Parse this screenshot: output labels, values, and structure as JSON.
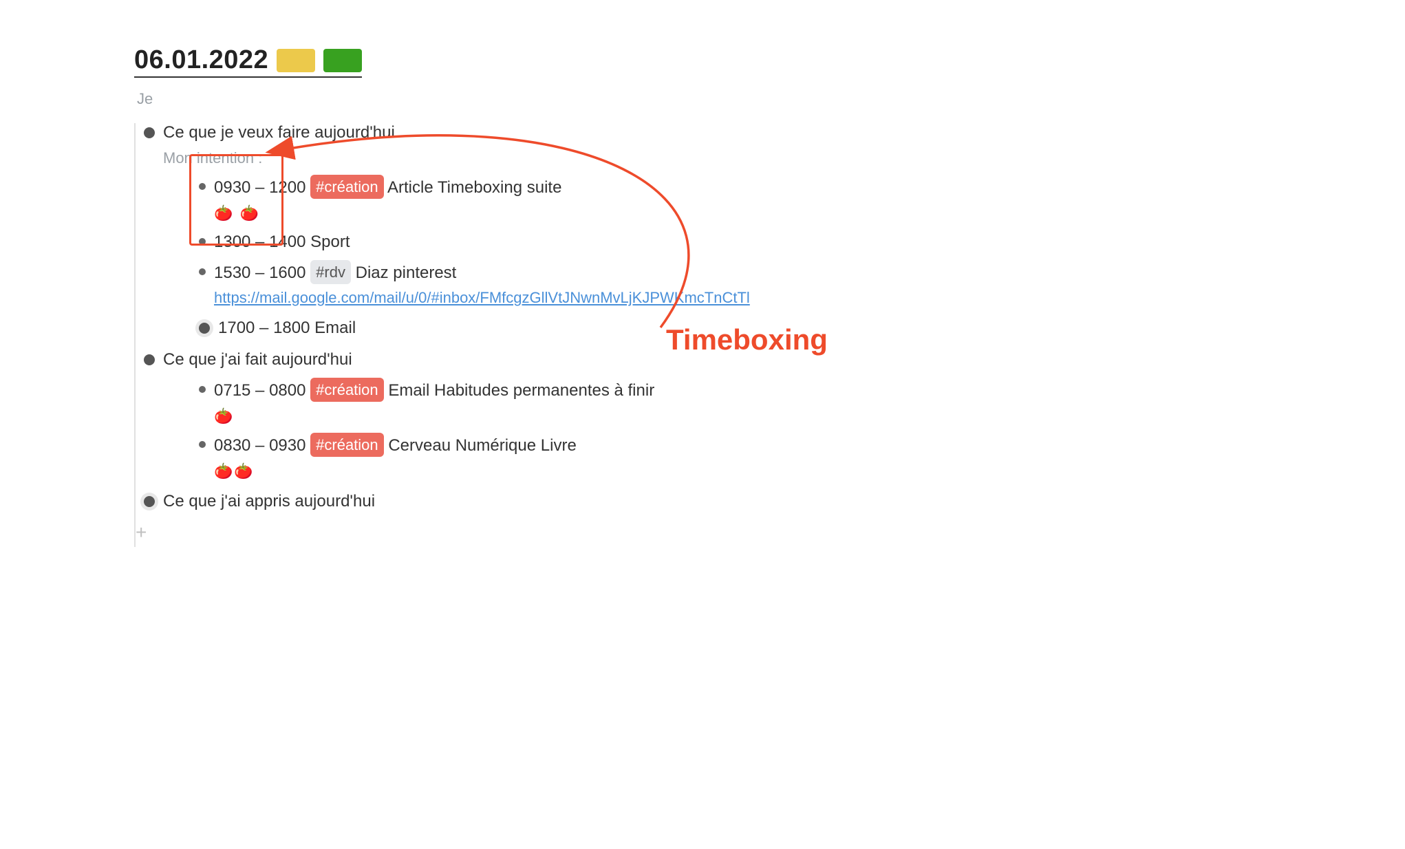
{
  "title": "06.01.2022",
  "swatches": [
    "#ecc94b",
    "#38a120"
  ],
  "meta": "Je",
  "section_want": {
    "label": "Ce que je veux faire aujourd'hui",
    "subtitle": "Mon intention :",
    "items": [
      {
        "time": "0930 – 1200",
        "tag_label": "#création",
        "tag_style": "red",
        "text": "Article Timeboxing suite",
        "tomatoes": "🍅 🍅"
      },
      {
        "time": "1300 – 1400",
        "text": "Sport"
      },
      {
        "time": "1530 – 1600",
        "tag_label": "#rdv",
        "tag_style": "grey",
        "text": "Diaz pinterest",
        "link": "https://mail.google.com/mail/u/0/#inbox/FMfcgzGllVtJNwnMvLjKJPWKmcTnCtTl"
      },
      {
        "time": "1700 – 1800",
        "text": "Email",
        "hollow": true
      }
    ]
  },
  "section_done": {
    "label": "Ce que j'ai fait aujourd'hui",
    "items": [
      {
        "time": "0715 – 0800",
        "tag_label": "#création",
        "tag_style": "red",
        "text": "Email Habitudes permanentes à finir",
        "tomatoes": "🍅"
      },
      {
        "time": "0830 – 0930",
        "tag_label": "#création",
        "tag_style": "red",
        "text": "Cerveau Numérique Livre",
        "tomatoes": "🍅🍅"
      }
    ]
  },
  "section_learned": {
    "label": "Ce que j'ai appris aujourd'hui"
  },
  "plus": "+",
  "annotation": "Timeboxing"
}
